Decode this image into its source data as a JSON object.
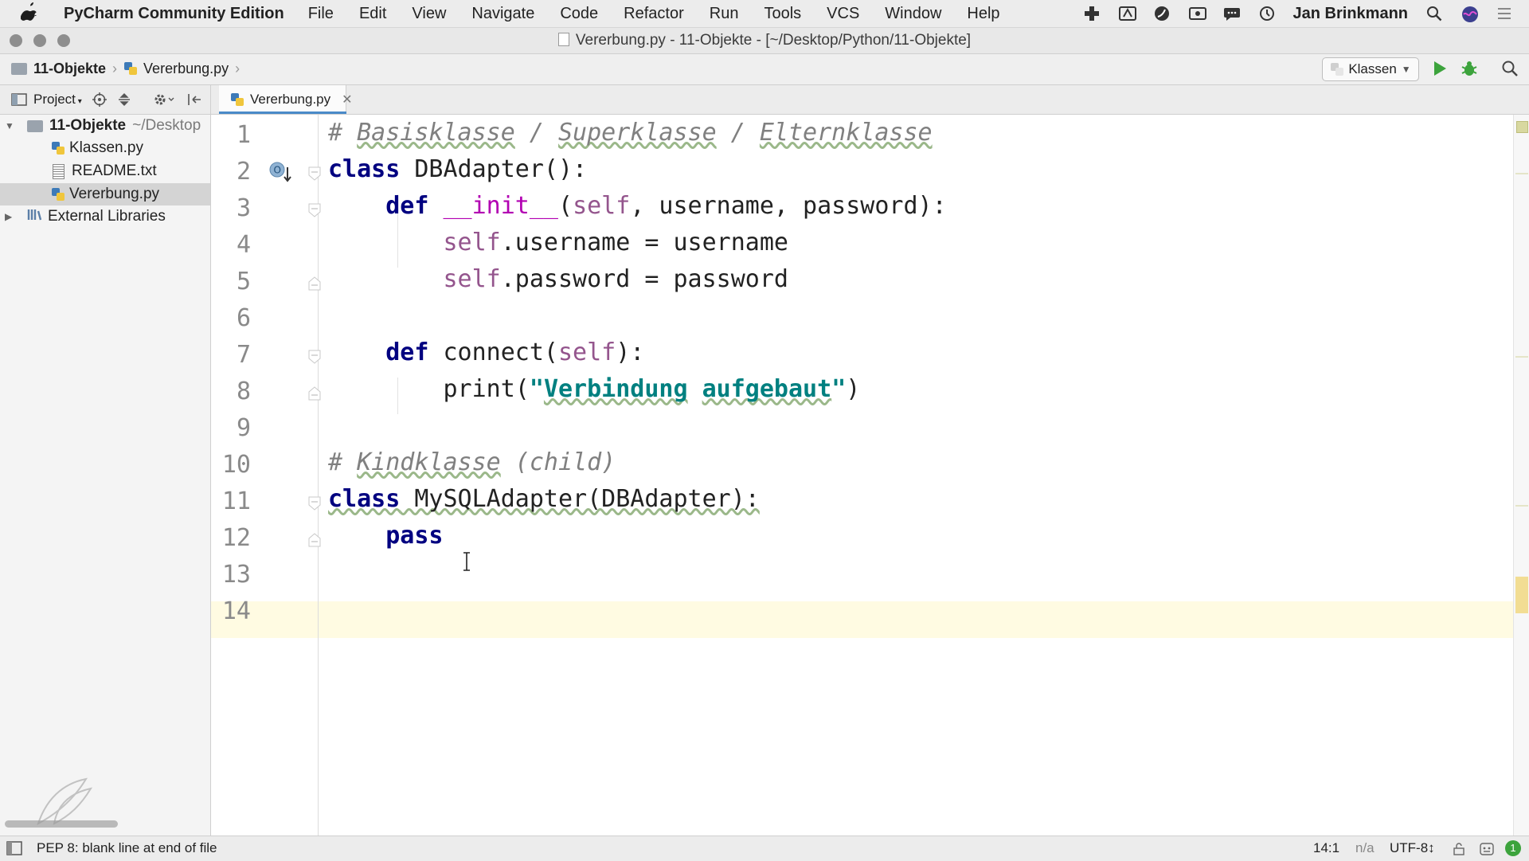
{
  "menubar": {
    "app_name": "PyCharm Community Edition",
    "menus": [
      "File",
      "Edit",
      "View",
      "Navigate",
      "Code",
      "Refactor",
      "Run",
      "Tools",
      "VCS",
      "Window",
      "Help"
    ],
    "user": "Jan Brinkmann"
  },
  "window": {
    "title": "Vererbung.py - 11-Objekte - [~/Desktop/Python/11-Objekte]"
  },
  "navbar": {
    "breadcrumbs": [
      "11-Objekte",
      "Vererbung.py"
    ],
    "run_config": "Klassen"
  },
  "project_panel": {
    "label": "Project",
    "tree": [
      {
        "label": "11-Objekte",
        "suffix": "~/Desktop",
        "type": "folder",
        "expanded": true
      },
      {
        "label": "Klassen.py",
        "type": "py"
      },
      {
        "label": "README.txt",
        "type": "txt"
      },
      {
        "label": "Vererbung.py",
        "type": "py",
        "selected": true
      },
      {
        "label": "External Libraries",
        "type": "lib"
      }
    ]
  },
  "editor": {
    "tab": "Vererbung.py",
    "line_numbers": [
      "1",
      "2",
      "3",
      "4",
      "5",
      "6",
      "7",
      "8",
      "9",
      "10",
      "11",
      "12",
      "13",
      "14"
    ],
    "lines": [
      "# Basisklasse / Superklasse / Elternklasse",
      "class DBAdapter():",
      "    def __init__(self, username, password):",
      "        self.username = username",
      "        self.password = password",
      "",
      "    def connect(self):",
      "        print(\"Verbindung aufgebaut\")",
      "",
      "# Kindklasse (child)",
      "class MySQLAdapter(DBAdapter):",
      "    pass",
      "",
      ""
    ],
    "current_line": 14
  },
  "statusbar": {
    "message": "PEP 8: blank line at end of file",
    "position": "14:1",
    "na": "n/a",
    "encoding": "UTF-8↕",
    "badge": "1"
  }
}
